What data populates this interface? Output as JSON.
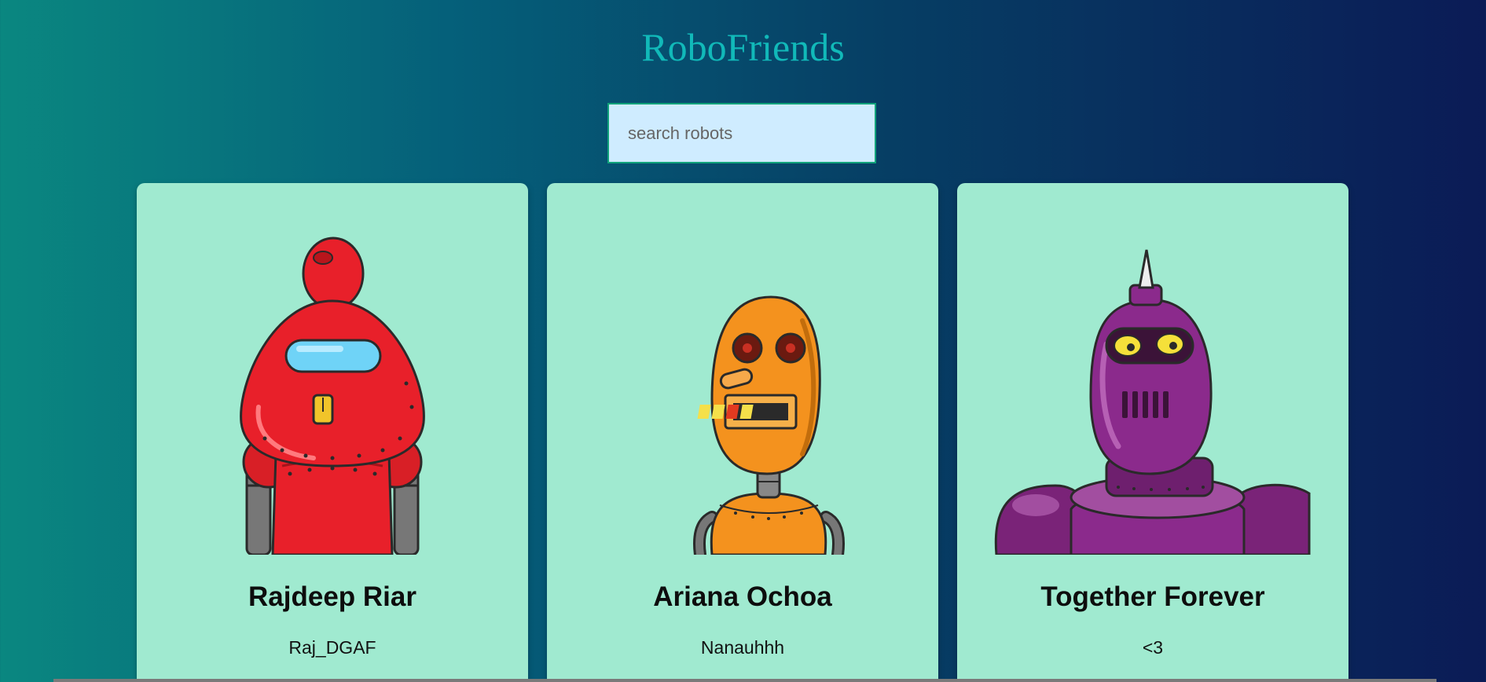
{
  "app": {
    "title": "RoboFriends"
  },
  "search": {
    "placeholder": "search robots",
    "value": ""
  },
  "robots": [
    {
      "name": "Rajdeep Riar",
      "username": "Raj_DGAF",
      "color": "#e8202a",
      "icon": "red-robot-icon"
    },
    {
      "name": "Ariana Ochoa",
      "username": "Nanauhhh",
      "color": "#f4921e",
      "icon": "orange-robot-icon"
    },
    {
      "name": "Together Forever",
      "username": "<3",
      "color": "#8b2a8c",
      "icon": "purple-robot-icon"
    }
  ],
  "colors": {
    "card_background": "#a0ead0",
    "title": "#11b9b9",
    "search_background": "#cfecff",
    "search_border": "#10a37a"
  }
}
